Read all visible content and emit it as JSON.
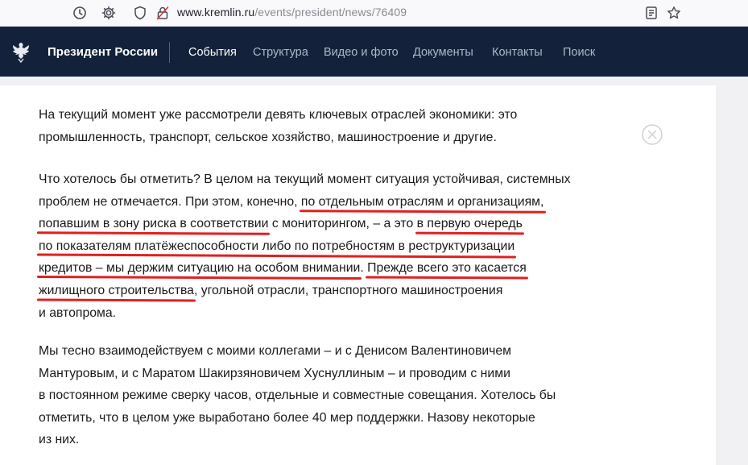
{
  "browser": {
    "url_host": "www.kremlin.ru",
    "url_path": "/events/president/news/76409"
  },
  "site": {
    "title": "Президент России",
    "nav": [
      {
        "label": "События",
        "active": true
      },
      {
        "label": "Структура",
        "active": false
      },
      {
        "label": "Видео и фото",
        "active": false
      },
      {
        "label": "Документы",
        "active": false
      },
      {
        "label": "Контакты",
        "active": false
      },
      {
        "label": "Поиск",
        "active": false
      }
    ]
  },
  "colors": {
    "nav_bg": "#13223a",
    "underline": "#e02020",
    "text": "#1a1a1a"
  },
  "article": {
    "p1": {
      "l1": "На текущий момент уже рассмотрели девять ключевых отраслей экономики: это",
      "l2": "промышленность, транспорт, сельское хозяйство, машиностроение и другие."
    },
    "p2": {
      "l1": "Что хотелось бы отметить? В целом на текущий момент ситуация устойчивая, системных",
      "l2a": "проблем не отмечается. При этом, конечно, ",
      "l2b": "по отдельным отраслям и организациям,",
      "l3a": "попавшим в зону риска в соответствии",
      "l3b": " с мониторингом, – а это ",
      "l3c": "в первую очередь",
      "l4": "по показателям платёжеспособности либо по потребностям в реструктуризации",
      "l5a": "кредитов – мы держим ситуацию на особом внимании",
      "l5b": ". ",
      "l5c": "Прежде всего это касается",
      "l6a": "жилищного строительства",
      "l6b": ", угольной отрасли, транспортного машиностроения",
      "l7": "и автопрома."
    },
    "p3": {
      "l1": "Мы тесно взаимодействуем с моими коллегами – и с Денисом Валентиновичем",
      "l2": "Мантуровым, и с Маратом Шакирзяновичем Хуснуллиным – и проводим с ними",
      "l3": "в постоянном режиме сверку часов, отдельные и совместные совещания. Хотелось бы",
      "l4": "отметить, что в целом уже выработано более 40 мер поддержки. Назову некоторые",
      "l5": "из них."
    }
  }
}
